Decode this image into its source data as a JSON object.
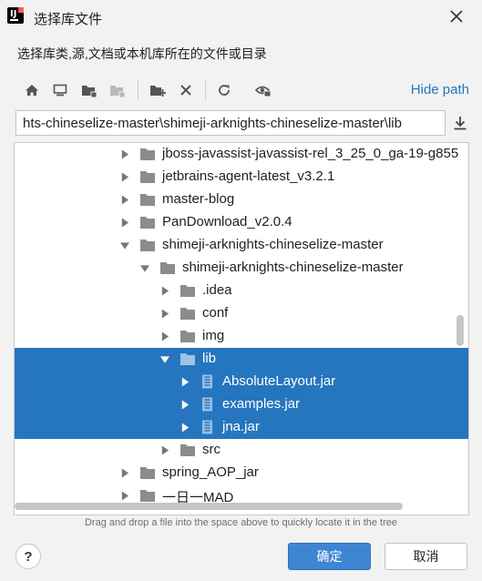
{
  "window": {
    "title": "选择库文件"
  },
  "description": "选择库类,源,文档或本机库所在的文件或目录",
  "toolbar": {
    "hide_path_label": "Hide path",
    "icons": [
      "home-icon",
      "desktop-icon",
      "project-folder-icon",
      "module-folder-icon",
      "new-folder-icon",
      "delete-icon",
      "refresh-icon",
      "show-hidden-icon"
    ]
  },
  "path_field": {
    "value": "hts-chineselize-master\\shimeji-arknights-chineselize-master\\lib"
  },
  "tree": {
    "rows": [
      {
        "label": "jboss-javassist-javassist-rel_3_25_0_ga-19-g855",
        "type": "folder",
        "expanded": false,
        "selected": false
      },
      {
        "label": "jetbrains-agent-latest_v3.2.1",
        "type": "folder",
        "expanded": false,
        "selected": false
      },
      {
        "label": "master-blog",
        "type": "folder",
        "expanded": false,
        "selected": false
      },
      {
        "label": "PanDownload_v2.0.4",
        "type": "folder",
        "expanded": false,
        "selected": false
      },
      {
        "label": "shimeji-arknights-chineselize-master",
        "type": "folder",
        "expanded": true,
        "selected": false
      },
      {
        "label": "shimeji-arknights-chineselize-master",
        "type": "folder",
        "expanded": true,
        "selected": false
      },
      {
        "label": ".idea",
        "type": "folder",
        "expanded": false,
        "selected": false
      },
      {
        "label": "conf",
        "type": "folder",
        "expanded": false,
        "selected": false
      },
      {
        "label": "img",
        "type": "folder",
        "expanded": false,
        "selected": false
      },
      {
        "label": "lib",
        "type": "folder",
        "expanded": true,
        "selected": true
      },
      {
        "label": "AbsoluteLayout.jar",
        "type": "jar",
        "expanded": false,
        "selected": true
      },
      {
        "label": "examples.jar",
        "type": "jar",
        "expanded": false,
        "selected": true
      },
      {
        "label": "jna.jar",
        "type": "jar",
        "expanded": false,
        "selected": true
      },
      {
        "label": "src",
        "type": "folder",
        "expanded": false,
        "selected": false
      },
      {
        "label": "spring_AOP_jar",
        "type": "folder",
        "expanded": false,
        "selected": false
      },
      {
        "label": "一日一MAD",
        "type": "folder",
        "expanded": false,
        "selected": false
      }
    ]
  },
  "hint": "Drag and drop a file into the space above to quickly locate it in the tree",
  "buttons": {
    "help": "?",
    "ok": "确定",
    "cancel": "取消"
  },
  "colors": {
    "selection": "#2675bf",
    "link": "#2675bf",
    "primary_button": "#3e86d4",
    "folder": "#8c8c8c",
    "jar": "#6aa4e0"
  }
}
